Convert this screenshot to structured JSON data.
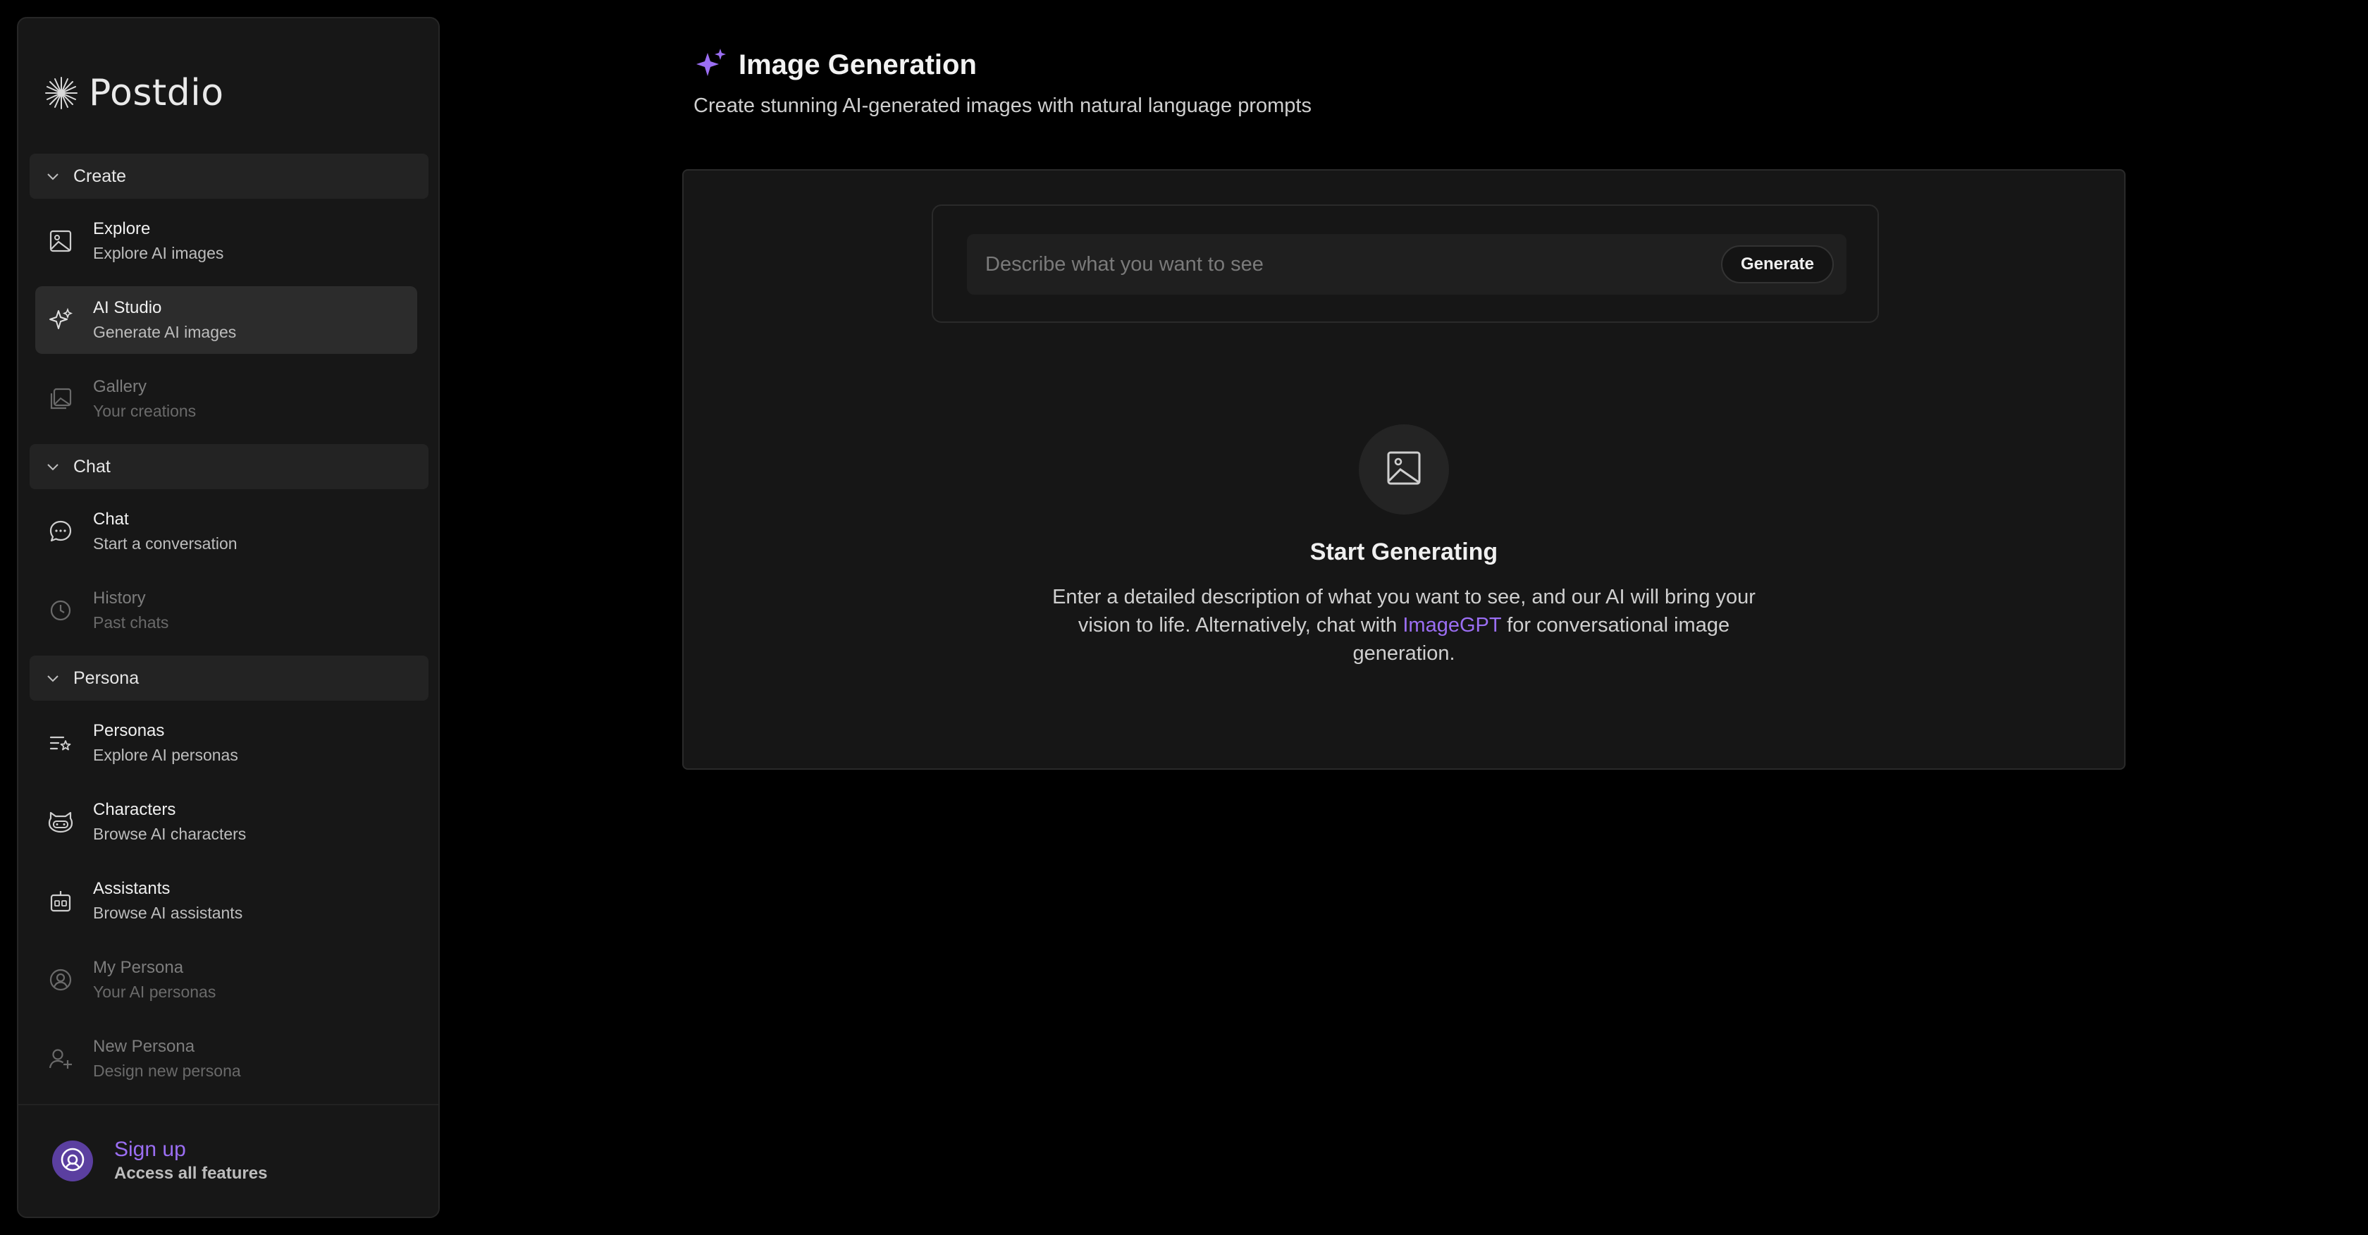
{
  "brand": {
    "name": "Postdio",
    "icon": "sparkle-star-icon"
  },
  "sidebar": {
    "sections": [
      {
        "label": "Create",
        "items": [
          {
            "title": "Explore",
            "subtitle": "Explore AI images",
            "icon": "image-icon",
            "state": "normal"
          },
          {
            "title": "AI Studio",
            "subtitle": "Generate AI images",
            "icon": "sparkles-icon",
            "state": "active"
          },
          {
            "title": "Gallery",
            "subtitle": "Your creations",
            "icon": "gallery-icon",
            "state": "dim"
          }
        ]
      },
      {
        "label": "Chat",
        "items": [
          {
            "title": "Chat",
            "subtitle": "Start a conversation",
            "icon": "chat-bubble-icon",
            "state": "normal"
          },
          {
            "title": "History",
            "subtitle": "Past chats",
            "icon": "clock-icon",
            "state": "dim"
          }
        ]
      },
      {
        "label": "Persona",
        "items": [
          {
            "title": "Personas",
            "subtitle": "Explore AI personas",
            "icon": "list-star-icon",
            "state": "normal"
          },
          {
            "title": "Characters",
            "subtitle": "Browse AI characters",
            "icon": "cat-face-icon",
            "state": "normal"
          },
          {
            "title": "Assistants",
            "subtitle": "Browse AI assistants",
            "icon": "bot-icon",
            "state": "normal"
          },
          {
            "title": "My Persona",
            "subtitle": "Your AI personas",
            "icon": "user-circle-icon",
            "state": "dim"
          },
          {
            "title": "New Persona",
            "subtitle": "Design new persona",
            "icon": "user-plus-icon",
            "state": "dim"
          }
        ]
      }
    ],
    "signup": {
      "title": "Sign up",
      "subtitle": "Access all features"
    }
  },
  "header": {
    "title": "Image Generation",
    "subtitle": "Create stunning AI-generated images with natural language prompts"
  },
  "prompt": {
    "placeholder": "Describe what you want to see",
    "value": "",
    "button_label": "Generate"
  },
  "empty_state": {
    "title": "Start Generating",
    "description_before": "Enter a detailed description of what you want to see, and our AI will bring your vision to life. Alternatively, chat with ",
    "link_text": "ImageGPT",
    "description_after": " for conversational image generation."
  },
  "colors": {
    "accent": "#9b6ef3",
    "background": "#000000",
    "surface": "#161616",
    "sidebar": "#171717"
  }
}
